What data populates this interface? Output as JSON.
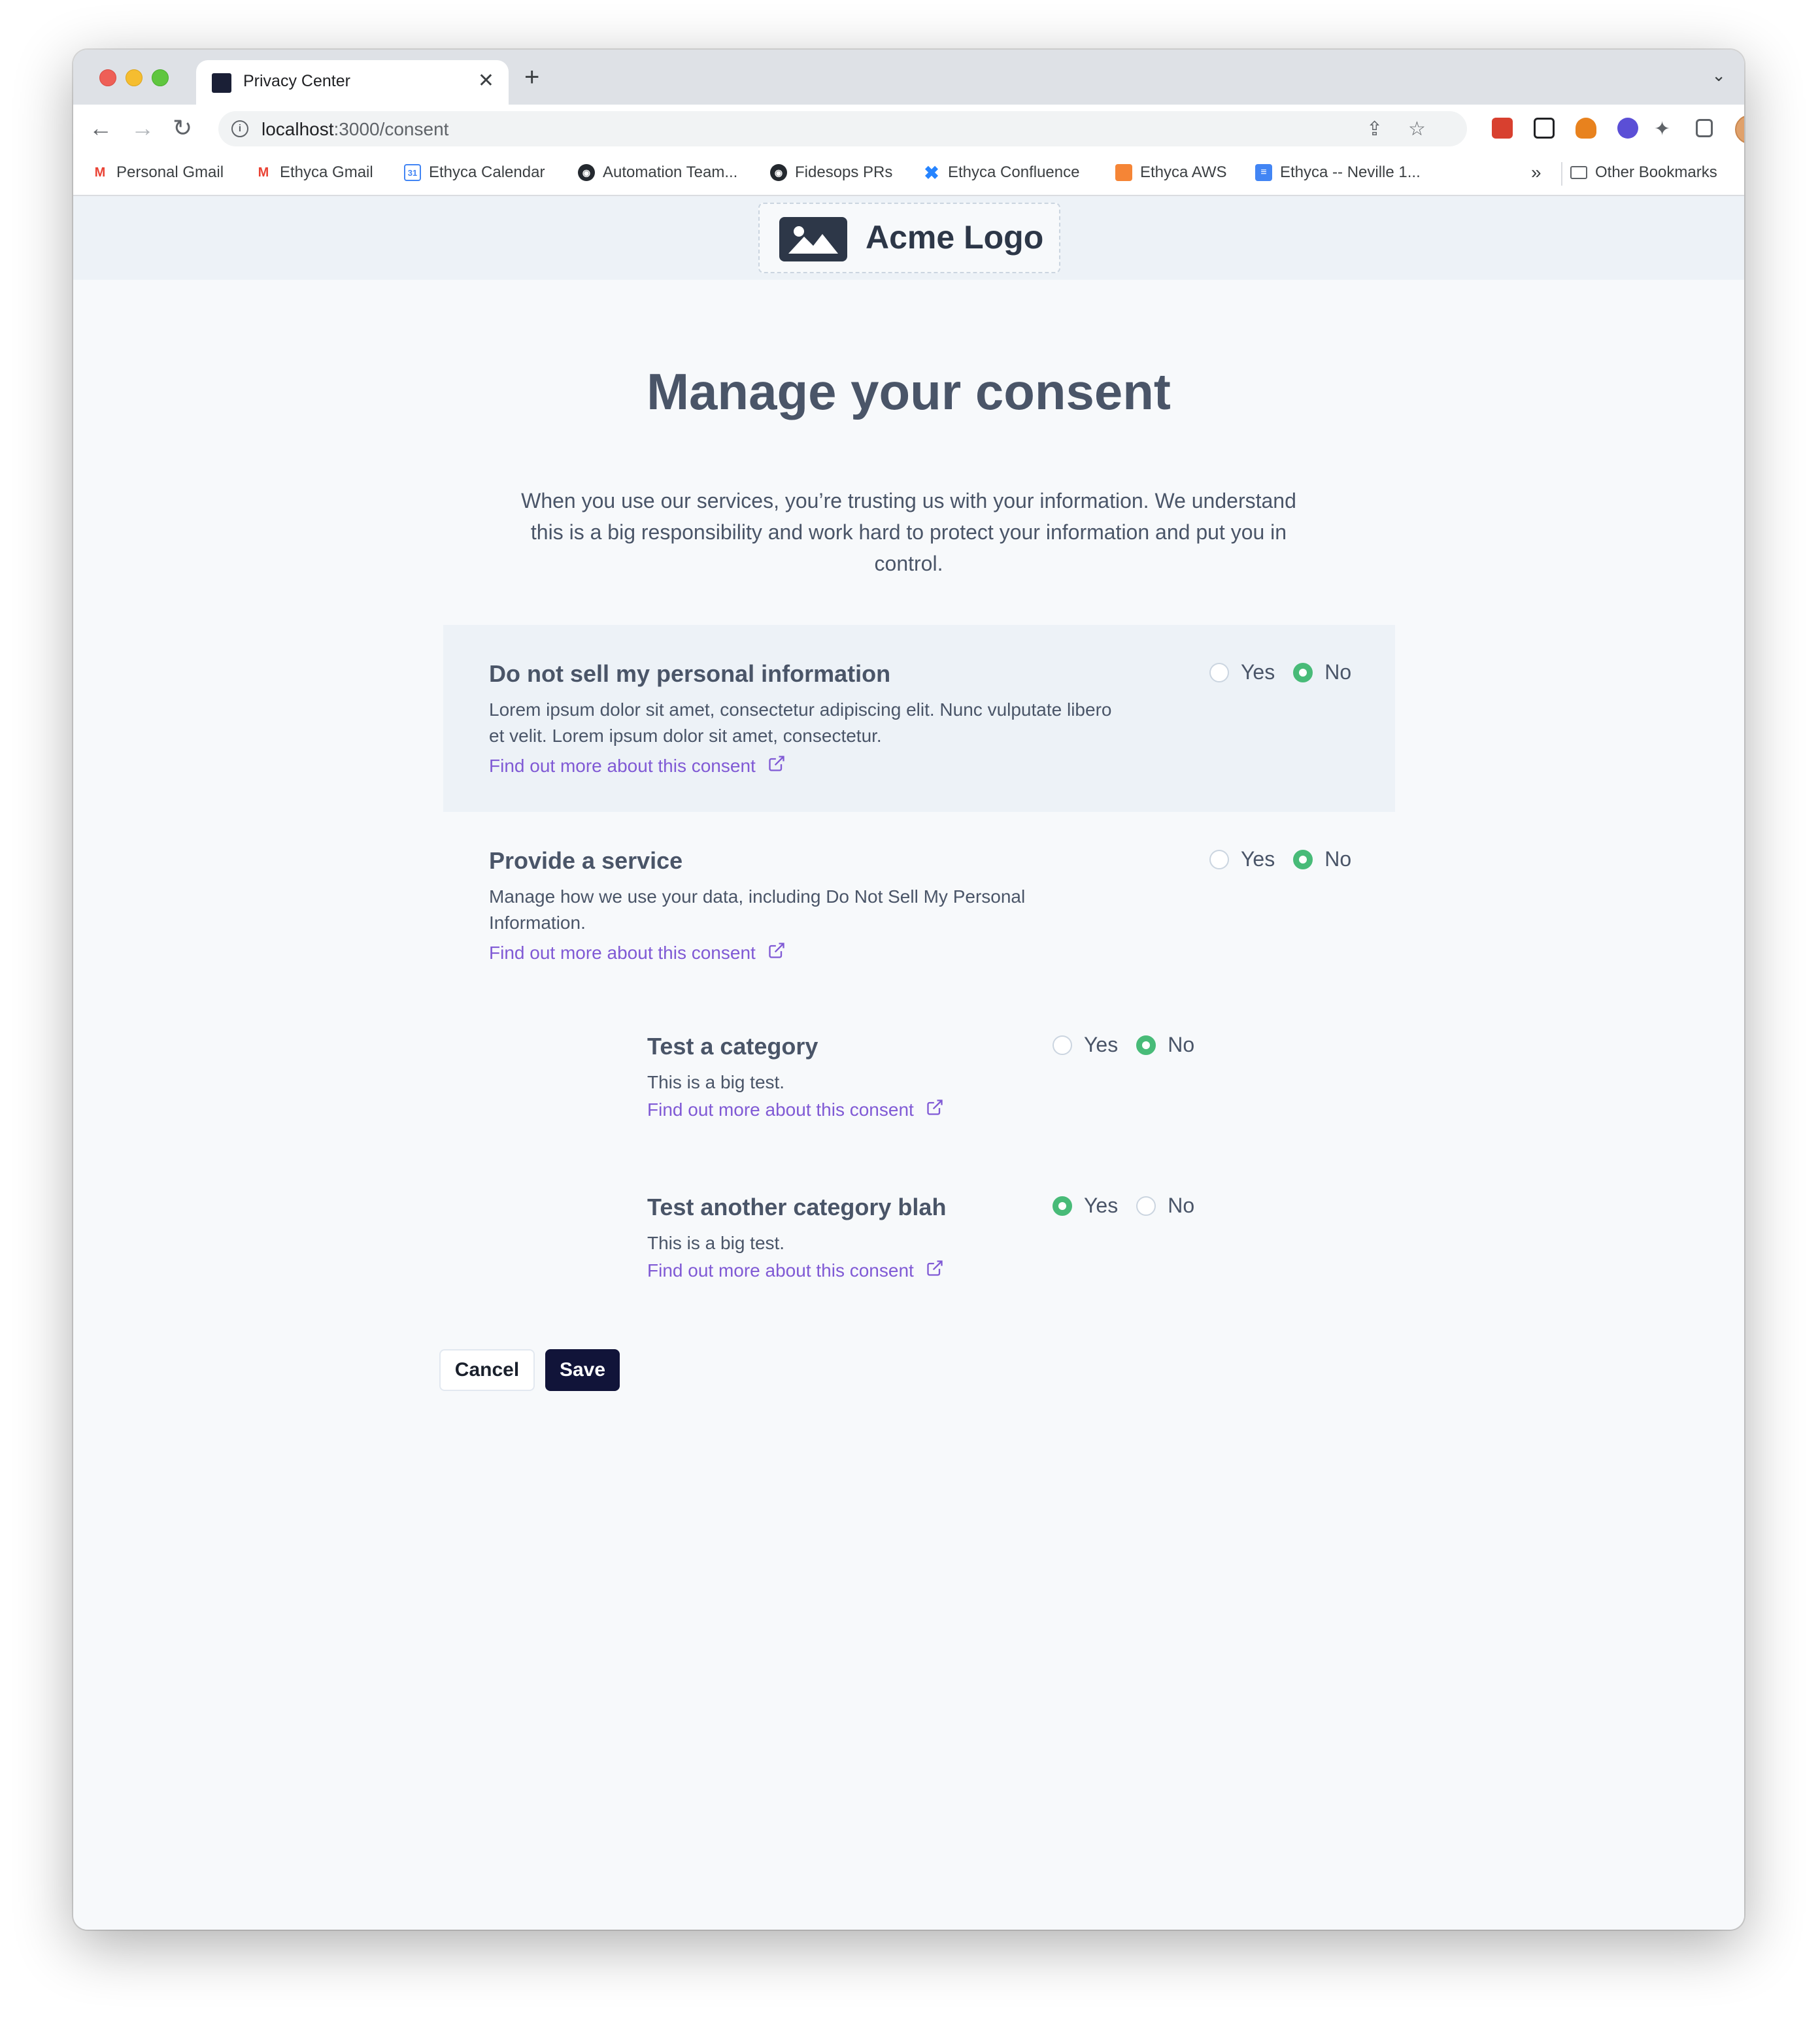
{
  "browser": {
    "tab_title": "Privacy Center",
    "tab_close": "✕",
    "new_tab": "+",
    "url_host": "localhost",
    "url_path": ":3000/consent",
    "bookmarks": [
      {
        "label": "Personal Gmail",
        "icon": "gmail-icon",
        "color": "#ea4335"
      },
      {
        "label": "Ethyca Gmail",
        "icon": "gmail-icon",
        "color": "#ea4335"
      },
      {
        "label": "Ethyca Calendar",
        "icon": "calendar-icon",
        "color": "#4285f4"
      },
      {
        "label": "Automation Team...",
        "icon": "github-icon",
        "color": "#24292f"
      },
      {
        "label": "Fidesops PRs",
        "icon": "github-icon",
        "color": "#24292f"
      },
      {
        "label": "Ethyca Confluence",
        "icon": "confluence-icon",
        "color": "#2684ff"
      },
      {
        "label": "Ethyca AWS",
        "icon": "aws-icon",
        "color": "#f58536"
      },
      {
        "label": "Ethyca -- Neville 1...",
        "icon": "docs-icon",
        "color": "#4285f4"
      }
    ],
    "bookmarks_more": "»",
    "other_bookmarks": "Other Bookmarks"
  },
  "header": {
    "logo_text": "Acme Logo"
  },
  "main": {
    "title": "Manage your consent",
    "subtitle": "When you use our services, you’re trusting us with your information. We understand this is a big responsibility and work hard to protect your information and put you in control."
  },
  "consents": [
    {
      "title": "Do not sell my personal information",
      "description": "Lorem ipsum dolor sit amet, consectetur adipiscing elit. Nunc vulputate libero et velit. Lorem ipsum dolor sit amet, consectetur.",
      "link": "Find out more about this consent",
      "yes_label": "Yes",
      "no_label": "No",
      "selected": "No"
    },
    {
      "title": "Provide a service",
      "description": "Manage how we use your data, including Do Not Sell My Personal Information.",
      "link": "Find out more about this consent",
      "yes_label": "Yes",
      "no_label": "No",
      "selected": "No"
    },
    {
      "title": "Test a category",
      "description": "This is a big test.",
      "link": "Find out more about this consent",
      "yes_label": "Yes",
      "no_label": "No",
      "selected": "No"
    },
    {
      "title": "Test another category blah",
      "description": "This is a big test.",
      "link": "Find out more about this consent",
      "yes_label": "Yes",
      "no_label": "No",
      "selected": "Yes"
    }
  ],
  "actions": {
    "cancel": "Cancel",
    "save": "Save"
  },
  "colors": {
    "accent": "#805ad5",
    "radio_on": "#48bb78",
    "primary_button": "#111439"
  }
}
